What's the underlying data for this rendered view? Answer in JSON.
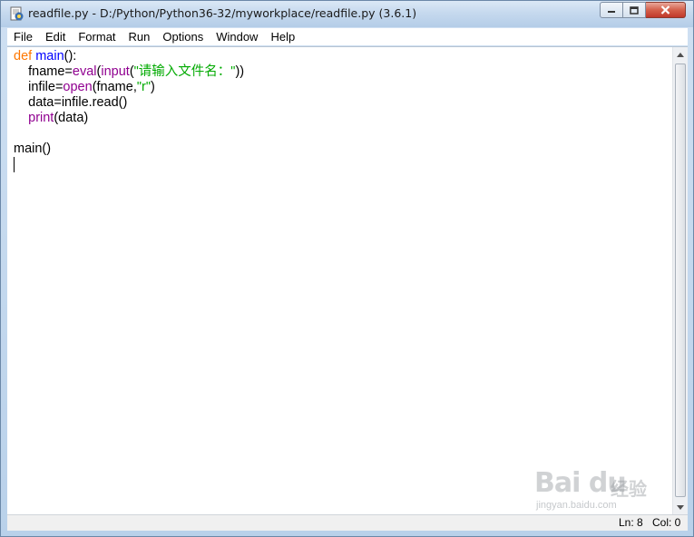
{
  "window": {
    "title": "readfile.py - D:/Python/Python36-32/myworkplace/readfile.py (3.6.1)"
  },
  "menu": [
    "File",
    "Edit",
    "Format",
    "Run",
    "Options",
    "Window",
    "Help"
  ],
  "code": {
    "l1": {
      "kw": "def",
      "fn": "main",
      "rest": "():"
    },
    "l2": {
      "a": "fname=",
      "b1": "eval",
      "c": "(",
      "b2": "input",
      "d": "(",
      "s": "\"请输入文件名：\"",
      "e": "))"
    },
    "l3": {
      "a": "infile=",
      "b": "open",
      "c": "(fname,",
      "s": "\"r\"",
      "d": ")"
    },
    "l4": "data=infile.read()",
    "l5": {
      "b": "print",
      "c": "(data)"
    },
    "l7": "main()"
  },
  "status": {
    "line": "Ln: 8",
    "col": "Col: 0"
  },
  "watermark": {
    "logo": "Bai du",
    "cn": "经验",
    "url": "jingyan.baidu.com"
  },
  "icons": {
    "app": "python-idle-icon",
    "minimize": "minimize-icon",
    "maximize": "maximize-icon",
    "close": "close-icon"
  },
  "colors": {
    "keyword": "#ff7700",
    "builtin": "#900090",
    "definition": "#0000ff",
    "string": "#00aa00"
  }
}
